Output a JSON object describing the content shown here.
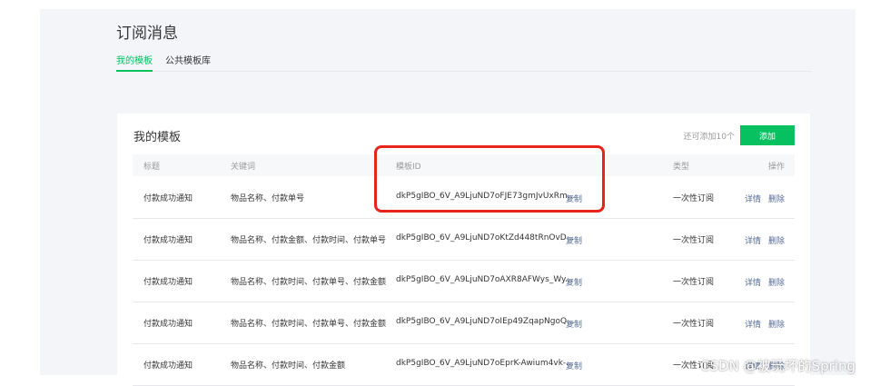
{
  "page": {
    "title": "订阅消息",
    "tabs": [
      {
        "label": "我的模板",
        "active": true
      },
      {
        "label": "公共模板库",
        "active": false
      }
    ]
  },
  "card": {
    "title": "我的模板",
    "quota_text": "还可添加10个",
    "add_button": "添加"
  },
  "table": {
    "headers": {
      "title": "标题",
      "keywords": "关键词",
      "template_id": "模板ID",
      "type": "类型",
      "actions": "操作"
    },
    "rows": [
      {
        "title": "付款成功通知",
        "keywords": "物品名称、付款单号",
        "template_id": "dkP5gIBO_6V_A9LjuND7oFJE73gmJvUxRm...",
        "copy": "复制",
        "type": "一次性订阅",
        "detail": "详情",
        "delete": "删除"
      },
      {
        "title": "付款成功通知",
        "keywords": "物品名称、付款金额、付款时间、付款单号",
        "template_id": "dkP5gIBO_6V_A9LjuND7oKtZd448tRnOvD...",
        "copy": "复制",
        "type": "一次性订阅",
        "detail": "详情",
        "delete": "删除"
      },
      {
        "title": "付款成功通知",
        "keywords": "物品名称、付款时间、付款单号、付款金额",
        "template_id": "dkP5gIBO_6V_A9LjuND7oAXR8AFWys_Wy...",
        "copy": "复制",
        "type": "一次性订阅",
        "detail": "详情",
        "delete": "删除"
      },
      {
        "title": "付款成功通知",
        "keywords": "物品名称、付款时间、付款单号、付款金额",
        "template_id": "dkP5gIBO_6V_A9LjuND7oIEp49ZqapNgoQ...",
        "copy": "复制",
        "type": "一次性订阅",
        "detail": "详情",
        "delete": "删除"
      },
      {
        "title": "付款成功通知",
        "keywords": "物品名称、付款时间、付款金额",
        "template_id": "dkP5gIBO_6V_A9LjuND7oEprK-Awium4vk-...",
        "copy": "复制",
        "type": "一次性订阅",
        "detail": "详情",
        "delete": "删除"
      }
    ]
  },
  "watermark": "CSDN @被玩坏的Spring",
  "colors": {
    "accent": "#07c160",
    "link": "#576b95",
    "highlight_box": "#e8231a",
    "background": "#f4f5f9"
  }
}
